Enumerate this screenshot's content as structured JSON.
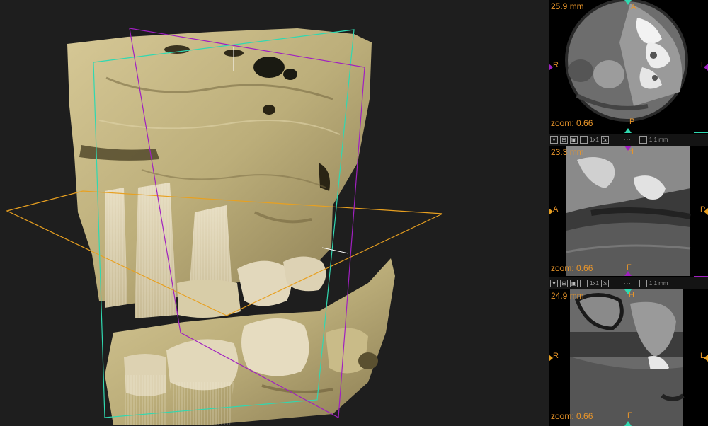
{
  "viewport3d": {
    "name": "3D volume rendering"
  },
  "views": [
    {
      "id": "axial",
      "distance": "25.9 mm",
      "zoom_label": "zoom: 0.66",
      "top_label": "A",
      "bottom_label": "P",
      "left_label": "R",
      "right_label": "L"
    },
    {
      "id": "sagittal",
      "distance": "23.3 mm",
      "zoom_label": "zoom: 0.66",
      "top_label": "H",
      "bottom_label": "F",
      "left_label": "A",
      "right_label": "P"
    },
    {
      "id": "coronal",
      "distance": "24.9 mm",
      "zoom_label": "zoom: 0.66",
      "top_label": "H",
      "bottom_label": "F",
      "left_label": "R",
      "right_label": "L"
    }
  ],
  "toolbars": [
    {
      "layout_label": "1x1",
      "scale_label": "1.1 mm"
    },
    {
      "layout_label": "1x1",
      "scale_label": "1.1 mm"
    }
  ],
  "colors": {
    "axial_plane": "#e8a020",
    "sagittal_plane": "#a020c0",
    "coronal_plane": "#30d8b0",
    "label_orange": "#e8952a",
    "bone": "#c9b98a"
  }
}
